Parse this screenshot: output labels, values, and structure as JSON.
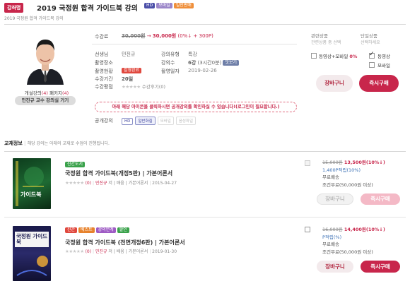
{
  "header": {
    "tag": "강좌명",
    "title": "2019 국정원 합격 가이드북 강의",
    "badges": [
      {
        "label": "HD",
        "color": "#4b4fa8"
      },
      {
        "label": "모바일",
        "color": "#9b86c9"
      },
      {
        "label": "일반판매",
        "color": "#ef8f3a"
      }
    ],
    "subtitle": "2019 국정원 합격 가이드북 강의"
  },
  "teacher": {
    "lecture_count_label": "개설강의",
    "lecture_count": "(4)",
    "review_label": "패키지",
    "review_count": "(4)",
    "link": "민진규 교수 강의실 가기"
  },
  "info": {
    "price_label": "수강료",
    "price_original": "30,000원",
    "price_arrow": "→",
    "price_final": "30,000원",
    "price_extra": "(0%↓ + 300P)",
    "teacher_label": "선생님",
    "teacher_value": "민진규",
    "type_label": "강의유형",
    "type_value": "특강",
    "place_label": "촬영장소",
    "place_value": "",
    "count_label": "강의수",
    "count_value": "6강",
    "count_detail": "(3시간0분)",
    "count_badge": "맛보기",
    "status_label": "촬영현황",
    "status_badge": "촬영완료",
    "date_label": "촬영일자",
    "date_value": "2019-02-26",
    "period_label": "수강기간",
    "period_value": "20일",
    "rating_label": "수강평점",
    "rating_stars": "★★★★★",
    "rating_text": "수강후기(0)",
    "notice": "아래 해당 아이콘을 클릭하시면 공개강의를 확인하실 수 있습니다!(로그인이 필요합니다.)",
    "public_label": "공개강의",
    "public_tags": [
      "HD",
      "일반화질",
      "모바일",
      "음성파일"
    ]
  },
  "purchase": {
    "related_label": "관련상품",
    "related_sub": "관련상품 중 선택",
    "single_label": "단일상품",
    "single_sub": "선택하세요",
    "opt_combo": "동영상+모바일",
    "opt_combo_badge": "0%",
    "opt_video": "동영상",
    "opt_mobile": "모바일",
    "cart": "장바구니",
    "buy": "즉시구매"
  },
  "materials": {
    "title": "교재정보",
    "note": "해당 강의는 아래의 교재로 수업이 진행됩니다.",
    "items": [
      {
        "badges": [
          {
            "label": "신간도서",
            "color": "#3aa24b"
          }
        ],
        "cover_title": "가이드북",
        "title": "국정원 합격 가이드북(개정5판) | 가본어론서",
        "stars": "★★★★★",
        "review": "(0)",
        "author": "민진규",
        "publisher_info": "저 | 배움 | 가본어론서",
        "date": "2015-04-27",
        "price_original": "15,000원",
        "price_final": "13,500원(10%↓)",
        "points": "1,400P적립(10%)",
        "shipping": "무료배송",
        "shipping_cond": "조건무료(50,000원 이상)",
        "cart": "장바구니",
        "buy": "즉시구매",
        "active": false
      },
      {
        "badges": [
          {
            "label": "신간",
            "color": "#e0483e"
          },
          {
            "label": "베스트",
            "color": "#e7832d"
          },
          {
            "label": "강의연계",
            "color": "#9e5bc4"
          },
          {
            "label": "할인",
            "color": "#3aa24b"
          }
        ],
        "cover_title": "국정원 가이드북",
        "title": "국정원 합격 가이드북 (전면개정6판) | 가본어론서",
        "stars": "★★★★★",
        "review": "(0)",
        "author": "민진규",
        "publisher_info": "저 | 배움 | 가본어론서",
        "date": "2019-01-30",
        "price_original": "16,000원",
        "price_final": "14,400원(10%↓)",
        "points": "P적립(%)",
        "shipping": "무료배송",
        "shipping_cond": "조건무료(50,000원 이상)",
        "cart": "장바구니",
        "buy": "즉시구매",
        "active": true
      }
    ]
  }
}
